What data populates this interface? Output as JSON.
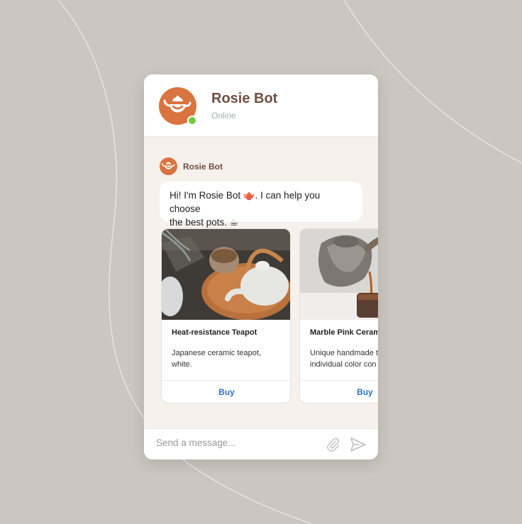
{
  "bot": {
    "name": "Rosie Bot",
    "status": "Online",
    "sender_label": "Rosie Bot"
  },
  "message": {
    "text_line1": "Hi! I'm Rosie Bot 🫖. I can help you choose",
    "text_line2": "the best pots. ☕"
  },
  "cards": [
    {
      "title": "Heat-resistance Teapot",
      "desc_line1": "Japanese ceramic teapot,",
      "desc_line2": "white.",
      "button": "Buy"
    },
    {
      "title": "Marble Pink Ceram",
      "desc_line1": "Unique handmade t",
      "desc_line2": "individual color con",
      "button": "Buy"
    }
  ],
  "composer": {
    "placeholder": "Send a message..."
  },
  "colors": {
    "accent": "#d9733f",
    "brand_text": "#6f4e40",
    "online": "#6ccb3f",
    "link": "#2a73c9",
    "background": "#cbc6bf"
  },
  "icons": [
    "teapot-logo-icon",
    "attach-icon",
    "send-icon"
  ]
}
